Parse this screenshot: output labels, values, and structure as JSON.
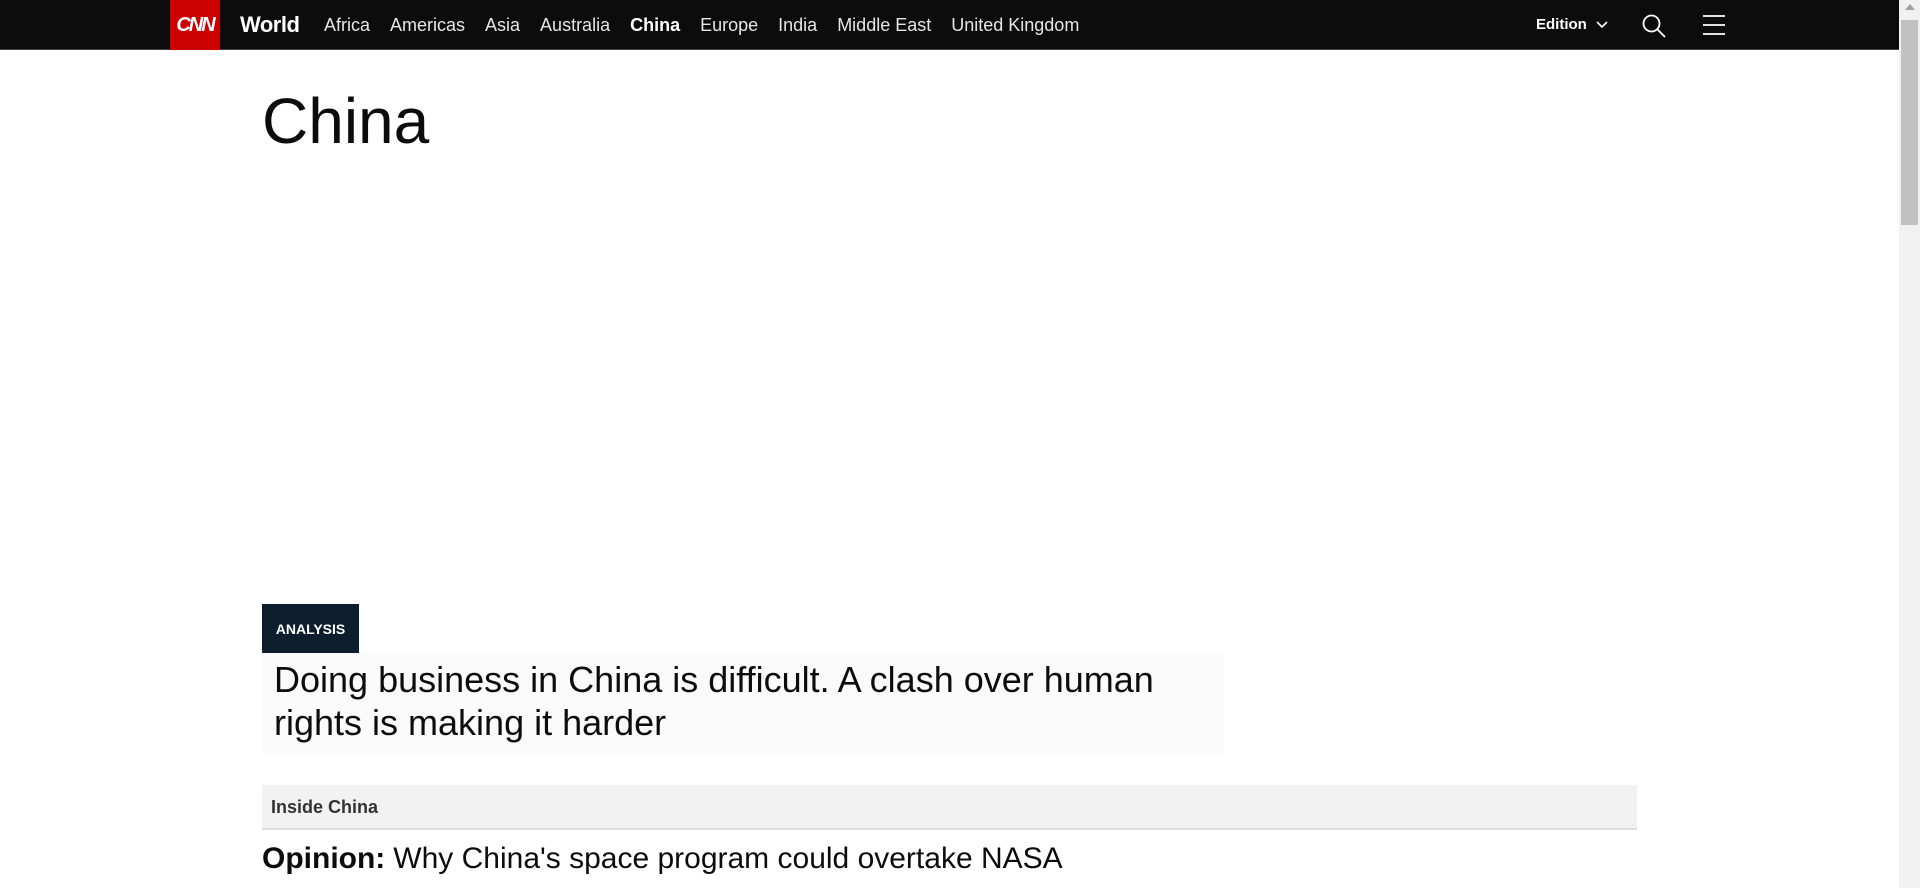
{
  "nav": {
    "logo": "CNN",
    "section": "World",
    "links": [
      "Africa",
      "Americas",
      "Asia",
      "Australia",
      "China",
      "Europe",
      "India",
      "Middle East",
      "United Kingdom"
    ],
    "active": "China",
    "edition": "Edition",
    "icons": [
      "search-icon",
      "hamburger-menu-icon"
    ]
  },
  "page": {
    "title": "China"
  },
  "feature": {
    "badge": "ANALYSIS",
    "headline": "Doing business in China is difficult. A clash over human rights is making it harder"
  },
  "inside": {
    "label": "Inside China",
    "item_prefix": "Opinion:",
    "item_title": "Why China's space program could overtake NASA"
  },
  "colors": {
    "nav_bg": "#0c0c0c",
    "brand": "#cc0000",
    "badge_bg": "#0c1d2e"
  }
}
